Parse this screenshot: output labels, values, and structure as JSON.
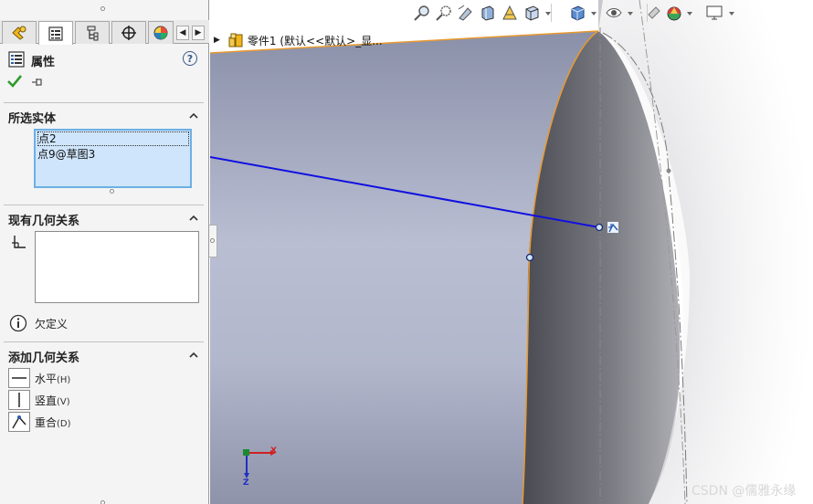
{
  "property_manager": {
    "title": "属性",
    "sections": {
      "selected_entities": {
        "title": "所选实体",
        "items": [
          "点2",
          "点9@草图3"
        ]
      },
      "existing_relations": {
        "title": "现有几何关系",
        "status_text": "欠定义"
      },
      "add_relations": {
        "title": "添加几何关系",
        "items": [
          {
            "label": "水平",
            "key": "(H)",
            "icon": "horizontal-relation-icon"
          },
          {
            "label": "竖直",
            "key": "(V)",
            "icon": "vertical-relation-icon"
          },
          {
            "label": "重合",
            "key": "(D)",
            "icon": "coincident-relation-icon"
          }
        ]
      }
    },
    "tabs": [
      {
        "name": "feature-manager-tab",
        "icon": "feature-manager-icon"
      },
      {
        "name": "property-manager-tab",
        "icon": "property-manager-icon"
      },
      {
        "name": "configuration-manager-tab",
        "icon": "configuration-manager-icon"
      },
      {
        "name": "dimxpert-manager-tab",
        "icon": "crosshair-icon"
      },
      {
        "name": "display-manager-tab",
        "icon": "display-manager-icon"
      }
    ]
  },
  "viewport": {
    "feature_tree_label": "零件1  (默认<<默认>_显...",
    "triad": {
      "x_label": "X",
      "z_label": "Z"
    },
    "watermark": "CSDN @儒雅永缘"
  },
  "colors": {
    "accept": "#2e9a2e",
    "sketch_line": "#1010e0",
    "edge_highlight": "#e89a30",
    "selection_fill": "#cfe5fb",
    "selection_border": "#6cb0e6"
  }
}
